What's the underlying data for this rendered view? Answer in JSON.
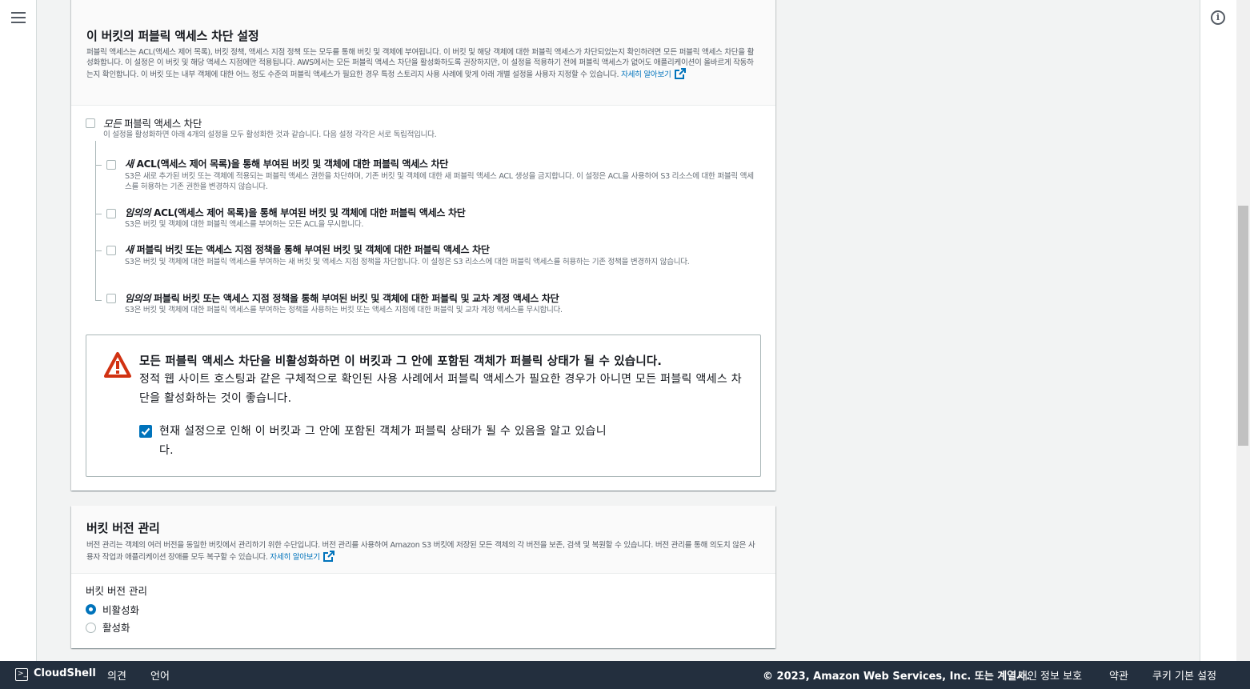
{
  "block_public_access": {
    "title": "이 버킷의 퍼블릭 액세스 차단 설정",
    "description": "퍼블릭 액세스는 ACL(액세스 제어 목록), 버킷 정책, 액세스 지점 정책 또는 모두를 통해 버킷 및 객체에 부여됩니다. 이 버킷 및 해당 객체에 대한 퍼블릭 액세스가 차단되었는지 확인하려면 모든 퍼블릭 액세스 차단을 활성화합니다. 이 설정은 이 버킷 및 해당 액세스 지점에만 적용됩니다. AWS에서는 모든 퍼블릭 액세스 차단을 활성화하도록 권장하지만, 이 설정을 적용하기 전에 퍼블릭 액세스가 없어도 애플리케이션이 올바르게 작동하는지 확인합니다. 이 버킷 또는 내부 객체에 대한 어느 정도 수준의 퍼블릭 액세스가 필요한 경우 특정 스토리지 사용 사례에 맞게 아래 개별 설정을 사용자 지정할 수 있습니다.",
    "learn_more": "자세히 알아보기",
    "block_all": {
      "title_em": "모든",
      "title_rest": " 퍼블릭 액세스 차단",
      "description": "이 설정을 활성화하면 아래 4개의 설정을 모두 활성화한 것과 같습니다. 다음 설정 각각은 서로 독립적입니다.",
      "checked": false
    },
    "options": [
      {
        "title_em": "새",
        "title_rest": " ACL(액세스 제어 목록)을 통해 부여된 버킷 및 객체에 대한 퍼블릭 액세스 차단",
        "description": "S3은 새로 추가된 버킷 또는 객체에 적용되는 퍼블릭 액세스 권한을 차단하며, 기존 버킷 및 객체에 대한 새 퍼블릭 액세스 ACL 생성을 금지합니다. 이 설정은 ACL을 사용하여 S3 리소스에 대한 퍼블릭 액세스를 허용하는 기존 권한을 변경하지 않습니다.",
        "checked": false
      },
      {
        "title_em": "임의의",
        "title_rest": " ACL(액세스 제어 목록)을 통해 부여된 버킷 및 객체에 대한 퍼블릭 액세스 차단",
        "description": "S3은 버킷 및 객체에 대한 퍼블릭 액세스를 부여하는 모든 ACL을 무시합니다.",
        "checked": false
      },
      {
        "title_em": "새",
        "title_rest": " 퍼블릭 버킷 또는 액세스 지점 정책을 통해 부여된 버킷 및 객체에 대한 퍼블릭 액세스 차단",
        "description": "S3은 버킷 및 객체에 대한 퍼블릭 액세스를 부여하는 새 버킷 및 액세스 지점 정책을 차단합니다. 이 설정은 S3 리소스에 대한 퍼블릭 액세스를 허용하는 기존 정책을 변경하지 않습니다.",
        "checked": false
      },
      {
        "title_em": "임의의",
        "title_rest": " 퍼블릭 버킷 또는 액세스 지점 정책을 통해 부여된 버킷 및 객체에 대한 퍼블릭 및 교차 계정 액세스 차단",
        "description": "S3은 버킷 및 객체에 대한 퍼블릭 액세스를 부여하는 정책을 사용하는 버킷 또는 액세스 지점에 대한 퍼블릭 및 교차 계정 액세스를 무시합니다.",
        "checked": false
      }
    ],
    "warning": {
      "title": "모든 퍼블릭 액세스 차단을 비활성화하면 이 버킷과 그 안에 포함된 객체가 퍼블릭 상태가 될 수 있습니다.",
      "body": "정적 웹 사이트 호스팅과 같은 구체적으로 확인된 사용 사례에서 퍼블릭 액세스가 필요한 경우가 아니면 모든 퍼블릭 액세스 차단을 활성화하는 것이 좋습니다.",
      "ack_label": "현재 설정으로 인해 이 버킷과 그 안에 포함된 객체가 퍼블릭 상태가 될 수 있음을 알고 있습니다.",
      "ack_checked": true
    }
  },
  "versioning": {
    "title": "버킷 버전 관리",
    "description": "버전 관리는 객체의 여러 버전을 동일한 버킷에서 관리하기 위한 수단입니다. 버전 관리를 사용하여 Amazon S3 버킷에 저장된 모든 객체의 각 버전을 보존, 검색 및 복원할 수 있습니다. 버전 관리를 통해 의도치 않은 사용자 작업과 애플리케이션 장애를 모두 복구할 수 있습니다.",
    "learn_more": "자세히 알아보기",
    "field_label": "버킷 버전 관리",
    "options": [
      "비활성화",
      "활성화"
    ],
    "selected": "비활성화"
  },
  "footer": {
    "cloudshell": "CloudShell",
    "feedback": "의견",
    "language": "언어",
    "copyright": "© 2023, Amazon Web Services, Inc. 또는 계열사.",
    "privacy": "개인 정보 보호",
    "terms": "약관",
    "cookies": "쿠키 기본 설정"
  },
  "icons": [
    "menu-icon",
    "info-icon",
    "external-link-icon",
    "warning-icon",
    "checkmark-icon",
    "cloudshell-icon"
  ],
  "colors": {
    "link": "#0073bb",
    "warning": "#d13212",
    "footer_bg": "#232f3e",
    "checked": "#0073bb"
  }
}
